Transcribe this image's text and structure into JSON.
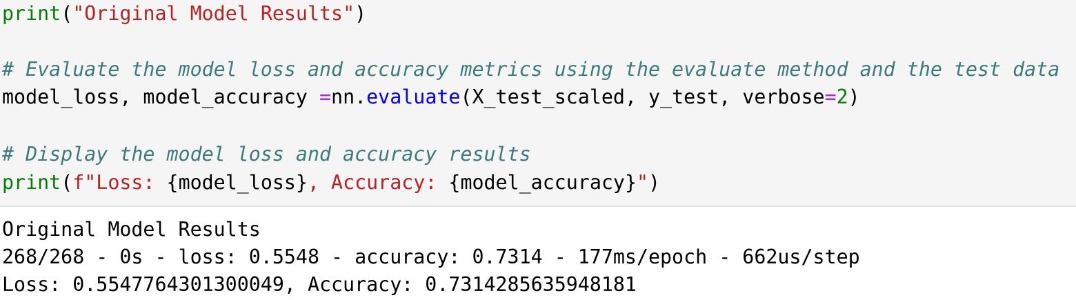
{
  "code_cell": {
    "line1": {
      "fn": "print",
      "open": "(",
      "str": "\"Original Model Results\"",
      "close": ")"
    },
    "line3": {
      "comment": "# Evaluate the model loss and accuracy metrics using the evaluate method and the test data"
    },
    "line4": {
      "lhs": "model_loss, model_accuracy ",
      "eq": "=",
      "obj": "nn.",
      "method": "evaluate",
      "args": "(X_test_scaled, y_test, verbose",
      "eq2": "=",
      "num": "2",
      "close": ")"
    },
    "line6": {
      "comment": "# Display the model loss and accuracy results"
    },
    "line7": {
      "fn": "print",
      "open": "(",
      "fstr_start": "f\"Loss: ",
      "expr1": "{model_loss}",
      "mid": ", Accuracy: ",
      "expr2": "{model_accuracy}",
      "fstr_end": "\"",
      "close": ")"
    }
  },
  "output": {
    "line1": "Original Model Results",
    "line2": "268/268 - 0s - loss: 0.5548 - accuracy: 0.7314 - 177ms/epoch - 662us/step",
    "line3": "Loss: 0.5547764301300049, Accuracy: 0.7314285635948181"
  }
}
